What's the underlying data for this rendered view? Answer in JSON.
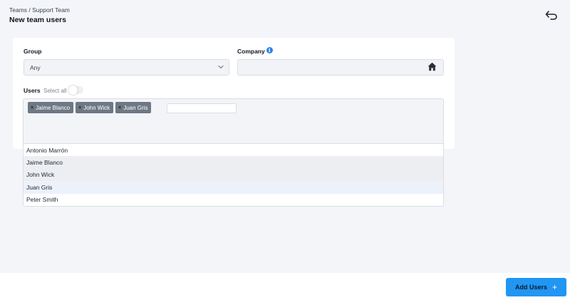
{
  "header": {
    "breadcrumb": "Teams / Support Team",
    "title": "New team users"
  },
  "form": {
    "group_label": "Group",
    "group_value": "Any",
    "company_label": "Company",
    "company_value": "",
    "users_label": "Users",
    "select_all_label": "Select all",
    "select_all_on": false,
    "selected_users": [
      "Jaime Blanco",
      "John Wick",
      "Juan Gris"
    ],
    "chip_remove_glyph": "×"
  },
  "dropdown": {
    "options": [
      {
        "label": "Antonio Marrón",
        "state": "normal"
      },
      {
        "label": "Jaime Blanco",
        "state": "selected"
      },
      {
        "label": "John Wick",
        "state": "selected"
      },
      {
        "label": "Juan Gris",
        "state": "highlighted"
      },
      {
        "label": "Peter Smith",
        "state": "normal"
      }
    ]
  },
  "actions": {
    "add_users_label": "Add Users",
    "add_users_icon": "+"
  },
  "icons": {
    "back": "back-arrow-icon",
    "info": "info-icon",
    "home": "home-icon",
    "chevron": "chevron-down-icon"
  },
  "colors": {
    "accent": "#2196f3",
    "chip": "#6e7885",
    "info": "#2b86e6"
  }
}
